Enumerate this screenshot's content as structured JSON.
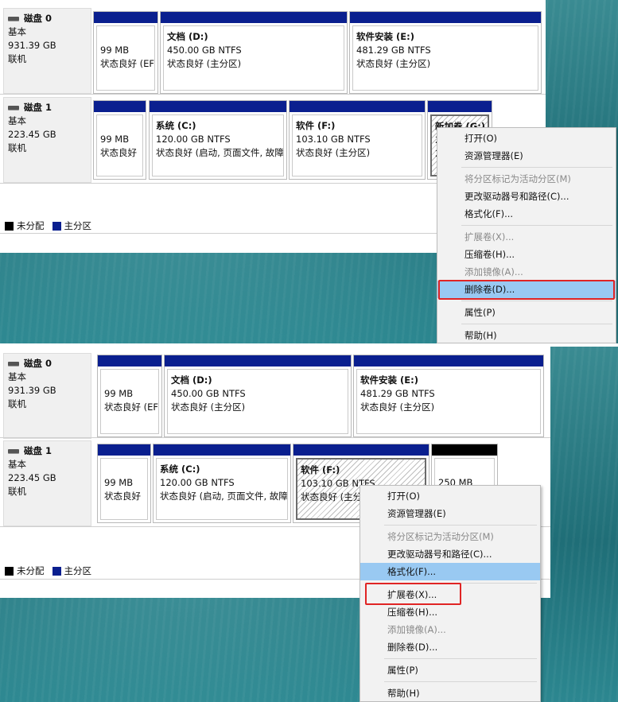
{
  "legend": {
    "unallocated": "未分配",
    "primary": "主分区"
  },
  "colors": {
    "primary_bar": "#0a1f8f",
    "unallocated_bar": "#000000",
    "highlight": "#99c9f2",
    "red_box": "#e02424"
  },
  "top": {
    "disk0": {
      "name": "磁盘 0",
      "type": "基本",
      "size": "931.39 GB",
      "status": "联机",
      "partitions": [
        {
          "size": "99 MB",
          "status": "状态良好 (EF"
        },
        {
          "label": "文档  (D:)",
          "size": "450.00 GB NTFS",
          "status": "状态良好 (主分区)"
        },
        {
          "label": "软件安装  (E:)",
          "size": "481.29 GB NTFS",
          "status": "状态良好 (主分区)"
        }
      ]
    },
    "disk1": {
      "name": "磁盘 1",
      "type": "基本",
      "size": "223.45 GB",
      "status": "联机",
      "partitions": [
        {
          "size": "99 MB",
          "status": "状态良好"
        },
        {
          "label": "系统  (C:)",
          "size": "120.00 GB NTFS",
          "status": "状态良好 (启动, 页面文件, 故障"
        },
        {
          "label": "软件  (F:)",
          "size": "103.10 GB NTFS",
          "status": "状态良好 (主分区)"
        },
        {
          "label": "新加卷  (G:)",
          "size": "2",
          "status": "2"
        }
      ]
    },
    "menu": [
      {
        "label": "打开(O)",
        "disabled": false
      },
      {
        "label": "资源管理器(E)",
        "disabled": false
      },
      {
        "label": "将分区标记为活动分区(M)",
        "disabled": true
      },
      {
        "label": "更改驱动器号和路径(C)...",
        "disabled": false
      },
      {
        "label": "格式化(F)...",
        "disabled": false
      },
      {
        "label": "扩展卷(X)...",
        "disabled": true
      },
      {
        "label": "压缩卷(H)...",
        "disabled": false
      },
      {
        "label": "添加镜像(A)...",
        "disabled": true
      },
      {
        "label": "删除卷(D)...",
        "disabled": false
      },
      {
        "label": "属性(P)",
        "disabled": false
      },
      {
        "label": "帮助(H)",
        "disabled": false
      }
    ]
  },
  "bottom": {
    "disk0": {
      "name": "磁盘 0",
      "type": "基本",
      "size": "931.39 GB",
      "status": "联机",
      "partitions": [
        {
          "size": "99 MB",
          "status": "状态良好 (EF"
        },
        {
          "label": "文档  (D:)",
          "size": "450.00 GB NTFS",
          "status": "状态良好 (主分区)"
        },
        {
          "label": "软件安装  (E:)",
          "size": "481.29 GB NTFS",
          "status": "状态良好 (主分区)"
        }
      ]
    },
    "disk1": {
      "name": "磁盘 1",
      "type": "基本",
      "size": "223.45 GB",
      "status": "联机",
      "partitions": [
        {
          "size": "99 MB",
          "status": "状态良好"
        },
        {
          "label": "系统  (C:)",
          "size": "120.00 GB NTFS",
          "status": "状态良好 (启动, 页面文件, 故障"
        },
        {
          "label": "软件  (F:)",
          "size": "103.10 GB NTFS",
          "status": "状态良好 (主分"
        },
        {
          "size": "250 MB"
        }
      ]
    },
    "menu": [
      {
        "label": "打开(O)",
        "disabled": false
      },
      {
        "label": "资源管理器(E)",
        "disabled": false
      },
      {
        "label": "将分区标记为活动分区(M)",
        "disabled": true
      },
      {
        "label": "更改驱动器号和路径(C)...",
        "disabled": false
      },
      {
        "label": "格式化(F)...",
        "disabled": false
      },
      {
        "label": "扩展卷(X)...",
        "disabled": false
      },
      {
        "label": "压缩卷(H)...",
        "disabled": false
      },
      {
        "label": "添加镜像(A)...",
        "disabled": true
      },
      {
        "label": "删除卷(D)...",
        "disabled": false
      },
      {
        "label": "属性(P)",
        "disabled": false
      },
      {
        "label": "帮助(H)",
        "disabled": false
      }
    ]
  }
}
